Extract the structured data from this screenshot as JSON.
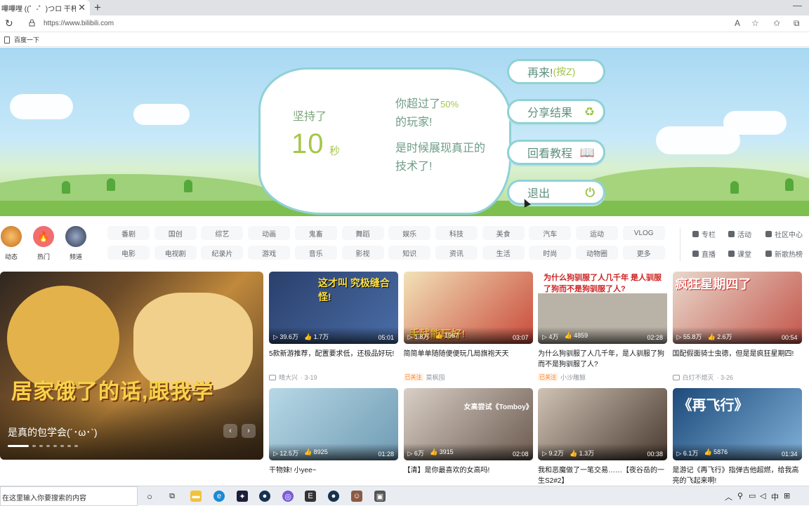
{
  "browser": {
    "tab_title": "(゜-゜)つロ 干杯~-bili",
    "tab_title_prefix": "嗶嗶哩 (",
    "url": "https://www.bilibili.com",
    "favorite": "百度一下"
  },
  "game": {
    "lasted_label": "坚持了",
    "seconds": "10",
    "seconds_unit": "秒",
    "beat_prefix": "你超过了",
    "beat_pct": "50%",
    "beat_suffix": "的玩家!",
    "taunt_line1": "是时候展现真正的",
    "taunt_line2": "技术了!",
    "buttons": [
      {
        "label": "再来!",
        "hint": "(按Z)"
      },
      {
        "label": "分享结果"
      },
      {
        "label": "回看教程"
      },
      {
        "label": "退出"
      }
    ]
  },
  "quick_entries": [
    {
      "label": "动态"
    },
    {
      "label": "热门"
    },
    {
      "label": "频道"
    }
  ],
  "channels_row1": [
    "番剧",
    "国创",
    "综艺",
    "动画",
    "鬼畜",
    "舞蹈",
    "娱乐",
    "科技",
    "美食",
    "汽车",
    "运动",
    "VLOG"
  ],
  "channels_row2": [
    "电影",
    "电视剧",
    "纪录片",
    "游戏",
    "音乐",
    "影视",
    "知识",
    "资讯",
    "生活",
    "时尚",
    "动物圈",
    "更多"
  ],
  "side_links": [
    "专栏",
    "活动",
    "社区中心",
    "直播",
    "课堂",
    "新歌热榜"
  ],
  "carousel": {
    "overlay_text": "居家饿了的话,跟我学",
    "title": "是真的包学会(´･ω･`)"
  },
  "cards": [
    {
      "thumb_text": "这才叫 究极缝合怪!",
      "views": "39.6万",
      "likes": "1.7万",
      "duration": "05:01",
      "title": "5款新游推荐，配置要求低，还极品好玩!",
      "follow": "",
      "up": "晴大兴",
      "date": "3-19"
    },
    {
      "thumb_text": "手残能玩好!",
      "views": "1.8万",
      "likes": "1967",
      "duration": "03:07",
      "title": "简简单单随随便便玩几局旗袍天天",
      "follow": "已关注",
      "up": "菜枫囤",
      "date": ""
    },
    {
      "thumb_text": "为什么狗驯服了人几千年 是人驯服了狗而不是狗驯服了人?",
      "views": "4万",
      "likes": "4859",
      "duration": "02:28",
      "title": "为什么狗驯服了人几千年，是人驯服了狗而不是狗驯服了人?",
      "follow": "已关注",
      "up": "小沙雕鲸",
      "date": ""
    },
    {
      "thumb_text": "疯狂星期四了",
      "views": "55.8万",
      "likes": "2.6万",
      "duration": "00:54",
      "title": "国配假面骑士虫德，但是是疯狂星期四!",
      "follow": "",
      "up": "白灯不熄灭",
      "date": "3-26"
    },
    {
      "thumb_text": "",
      "views": "12.5万",
      "likes": "8925",
      "duration": "01:28",
      "title": "干物妹! 小yee~",
      "follow": "",
      "up": "",
      "date": ""
    },
    {
      "thumb_text": "女高尝试《Tomboy》",
      "views": "6万",
      "likes": "3915",
      "duration": "02:08",
      "title": "【清】是你最喜欢的女高吗!",
      "follow": "",
      "up": "",
      "date": ""
    },
    {
      "thumb_text": "",
      "views": "9.2万",
      "likes": "1.3万",
      "duration": "00:38",
      "title": "我和恶魔做了一笔交易……【夜谷岳的一生S2#2】",
      "follow": "",
      "up": "",
      "date": ""
    },
    {
      "thumb_text": "《再飞行》",
      "views": "6.1万",
      "likes": "5876",
      "duration": "01:34",
      "title": "是游记《再飞行》指弹吉他超燃，给我高亮的飞起来啊!",
      "follow": "",
      "up": "",
      "date": ""
    }
  ],
  "taskbar": {
    "search_placeholder": "在这里输入你要搜索的内容",
    "ime": "中"
  }
}
